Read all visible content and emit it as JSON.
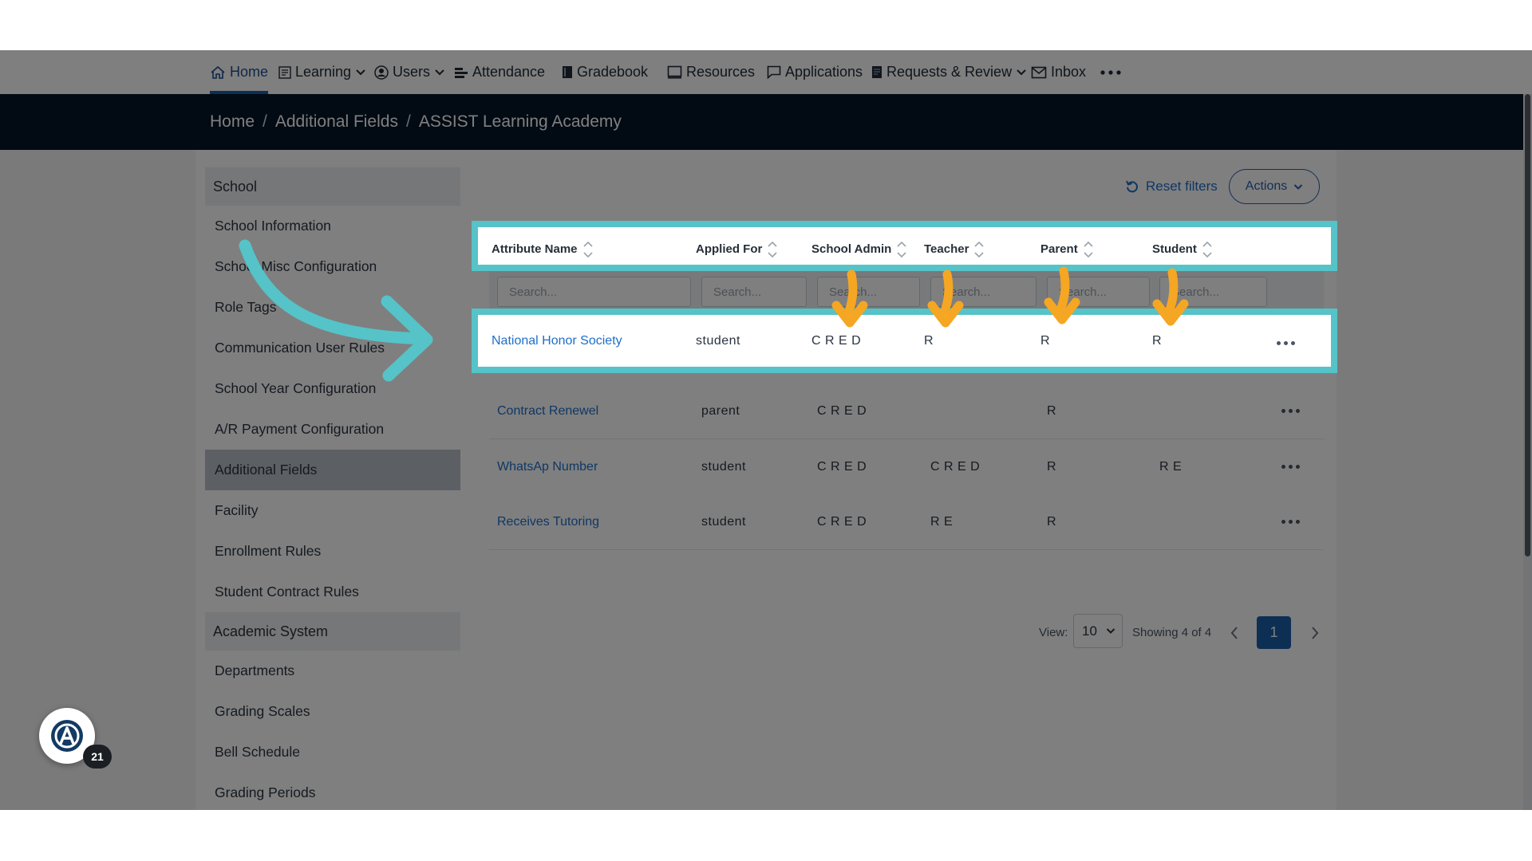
{
  "nav": {
    "items": [
      {
        "label": "Home",
        "icon": "home-icon"
      },
      {
        "label": "Learning",
        "icon": "learning-icon"
      },
      {
        "label": "Users",
        "icon": "user-icon"
      },
      {
        "label": "Attendance",
        "icon": "attendance-icon"
      },
      {
        "label": "Gradebook",
        "icon": "gradebook-icon"
      },
      {
        "label": "Resources",
        "icon": "resources-icon"
      },
      {
        "label": "Applications",
        "icon": "applications-icon"
      },
      {
        "label": "Requests & Review",
        "icon": "requests-icon"
      },
      {
        "label": "Inbox",
        "icon": "inbox-icon"
      }
    ],
    "active": "Home"
  },
  "breadcrumb": [
    "Home",
    "Additional Fields",
    "ASSIST Learning Academy"
  ],
  "sidebar": {
    "groups": [
      {
        "heading": "School",
        "items": [
          "School Information",
          "School Misc Configuration",
          "Role Tags",
          "Communication User Rules",
          "School Year Configuration",
          "A/R Payment Configuration",
          "Additional Fields",
          "Facility",
          "Enrollment Rules",
          "Student Contract Rules"
        ]
      },
      {
        "heading": "Academic System",
        "items": [
          "Departments",
          "Grading Scales",
          "Bell Schedule",
          "Grading Periods"
        ]
      }
    ],
    "active_item": "Additional Fields"
  },
  "toolbar": {
    "reset_label": "Reset filters",
    "actions_label": "Actions"
  },
  "table": {
    "columns": [
      "Attribute Name",
      "Applied For",
      "School Admin",
      "Teacher",
      "Parent",
      "Student"
    ],
    "filter_placeholder": "Search...",
    "rows": [
      {
        "name": "National Honor Society",
        "applied_for": "student",
        "school_admin": "C R E D",
        "teacher": "R",
        "parent": "R",
        "student": "R"
      },
      {
        "name": "Contract Renewel",
        "applied_for": "parent",
        "school_admin": "C R E D",
        "teacher": "",
        "parent": "R",
        "student": ""
      },
      {
        "name": "WhatsAp Number",
        "applied_for": "student",
        "school_admin": "C R E D",
        "teacher": "C R E D",
        "parent": "R",
        "student": "R E"
      },
      {
        "name": "Receives Tutoring",
        "applied_for": "student",
        "school_admin": "C R E D",
        "teacher": "R E",
        "parent": "R",
        "student": ""
      }
    ]
  },
  "pagination": {
    "view_label": "View:",
    "page_size": "10",
    "showing": "Showing 4 of 4",
    "current_page": "1"
  },
  "badge": {
    "count": "21"
  },
  "colors": {
    "accent": "#1d5fa8",
    "highlight": "#55c3c8",
    "arrow_orange": "#f5a623",
    "header_bar": "#041426"
  }
}
